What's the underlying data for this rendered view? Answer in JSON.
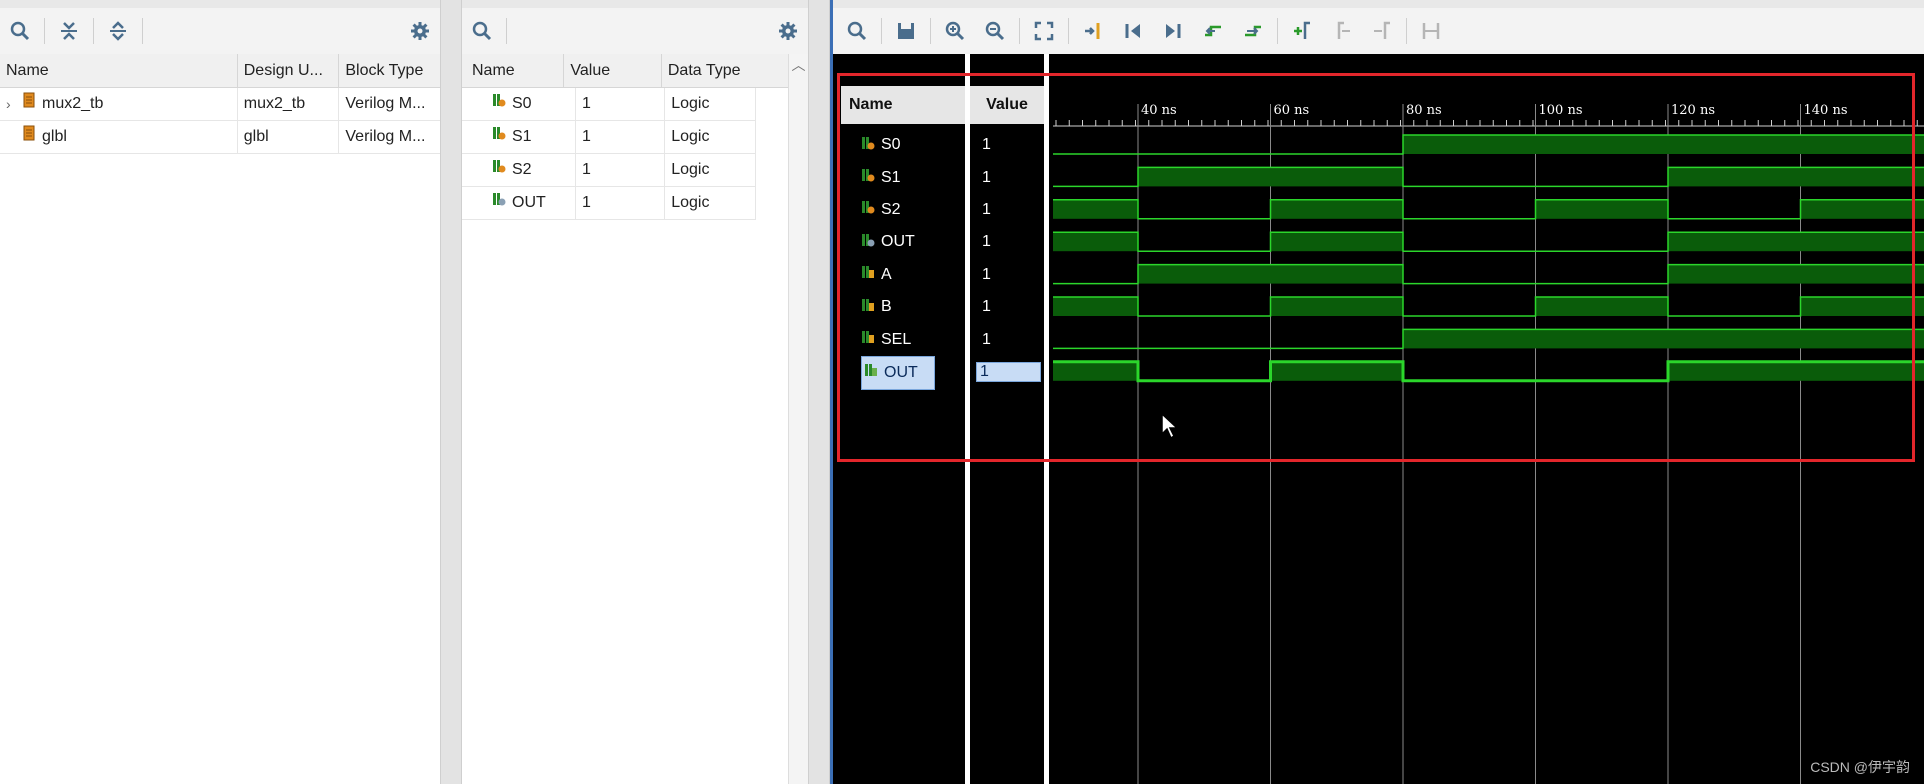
{
  "scope_panel": {
    "toolbar": {
      "search_icon": "search-icon",
      "collapse_icon": "collapse-all-icon",
      "expand_icon": "expand-all-icon",
      "settings_icon": "gear-icon"
    },
    "columns": [
      "Name",
      "Design U...",
      "Block Type"
    ],
    "rows": [
      {
        "name": "mux2_tb",
        "design_unit": "mux2_tb",
        "block_type": "Verilog M...",
        "expandable": true
      },
      {
        "name": "glbl",
        "design_unit": "glbl",
        "block_type": "Verilog M...",
        "expandable": false
      }
    ]
  },
  "objects_panel": {
    "columns": [
      "Name",
      "Value",
      "Data Type"
    ],
    "rows": [
      {
        "name": "S0",
        "value": "1",
        "type": "Logic"
      },
      {
        "name": "S1",
        "value": "1",
        "type": "Logic"
      },
      {
        "name": "S2",
        "value": "1",
        "type": "Logic"
      },
      {
        "name": "OUT",
        "value": "1",
        "type": "Logic"
      }
    ]
  },
  "wave_panel": {
    "toolbar_icons": [
      "search-icon",
      "save-icon",
      "zoom-in-icon",
      "zoom-out-icon",
      "zoom-fit-icon",
      "go-to-cursor-icon",
      "go-to-time-zero-icon",
      "go-to-last-time-icon",
      "previous-transition-icon",
      "next-transition-icon",
      "add-marker-icon",
      "previous-marker-icon",
      "next-marker-icon",
      "swap-cursors-icon"
    ],
    "name_header": "Name",
    "value_header": "Value",
    "time_labels": [
      "40 ns",
      "60 ns",
      "80 ns",
      "100 ns",
      "120 ns",
      "140 ns"
    ],
    "signals": [
      {
        "name": "S0",
        "value": "1",
        "kind": "out"
      },
      {
        "name": "S1",
        "value": "1",
        "kind": "out"
      },
      {
        "name": "S2",
        "value": "1",
        "kind": "out"
      },
      {
        "name": "OUT",
        "value": "1",
        "kind": "in"
      },
      {
        "name": "A",
        "value": "1",
        "kind": "reg"
      },
      {
        "name": "B",
        "value": "1",
        "kind": "reg"
      },
      {
        "name": "SEL",
        "value": "1",
        "kind": "reg"
      },
      {
        "name": "OUT",
        "value": "1",
        "kind": "wire",
        "selected": true
      }
    ],
    "waveforms": {
      "S0": [
        0,
        0,
        0,
        1,
        1,
        1,
        1
      ],
      "S1": [
        0,
        1,
        1,
        0,
        0,
        1,
        1
      ],
      "S2": [
        1,
        0,
        1,
        0,
        1,
        0,
        1
      ],
      "OUT": [
        1,
        0,
        1,
        0,
        0,
        1,
        1
      ],
      "A": [
        0,
        1,
        1,
        0,
        0,
        1,
        1
      ],
      "B": [
        1,
        0,
        1,
        0,
        1,
        0,
        1
      ],
      "SEL": [
        0,
        0,
        0,
        1,
        1,
        1,
        1
      ],
      "OUT2": [
        1,
        0,
        1,
        0,
        0,
        1,
        1
      ]
    },
    "highlight_color": "#e3262b",
    "wave_color": "#2bd62b",
    "wave_fill": "#0a5c0a"
  },
  "watermark": "CSDN @伊宇韵"
}
